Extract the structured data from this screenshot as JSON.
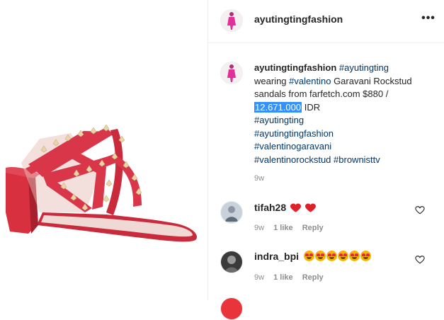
{
  "post": {
    "username": "ayutingtingfashion",
    "more_label": "•••"
  },
  "caption": {
    "username": "ayutingtingfashion",
    "hashtag_ayutingting": "#ayutingting",
    "text_wearing": "wearing",
    "hashtag_valentino": "#valentino",
    "text_garavani": "Garavani Rockstud sandals from farfetch.com $880 /",
    "highlighted_price": "12.671.000",
    "text_idr": "IDR",
    "tags": [
      "#ayutingting",
      "#ayutingtingfashion",
      "#valentinogaravani",
      "#valentinorockstud",
      "#brownisttv"
    ],
    "time": "9w"
  },
  "comments": [
    {
      "username": "tifah28",
      "time": "9w",
      "likes": "1 like",
      "reply": "Reply",
      "emoji": [
        "red-heart",
        "red-heart"
      ]
    },
    {
      "username": "indra_bpi",
      "time": "9w",
      "likes": "1 like",
      "reply": "Reply",
      "emoji": [
        "heart-eyes-emoji",
        "heart-eyes-emoji",
        "heart-eyes-emoji",
        "heart-eyes-emoji",
        "heart-eyes-emoji",
        "heart-eyes-emoji"
      ]
    }
  ],
  "colors": {
    "sandal_red": "#d9364a",
    "stud_gold": "#e8d6a8",
    "hashtag_blue": "#00376b",
    "selection_blue": "#3390ff"
  }
}
